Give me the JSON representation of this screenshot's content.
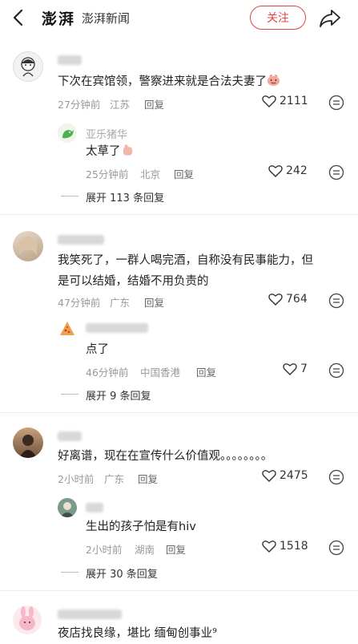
{
  "header": {
    "logo_text": "澎湃",
    "app_name": "澎湃新闻",
    "follow_label": "关注"
  },
  "comments": [
    {
      "text": "下次在宾馆领，警察进来就是合法夫妻了",
      "time": "27分钟前",
      "location": "江苏",
      "reply_label": "回复",
      "likes": "2111",
      "sub_reply": {
        "username": "亚乐猪华",
        "text": "太草了",
        "time": "25分钟前",
        "location": "北京",
        "reply_label": "回复",
        "likes": "242"
      },
      "expand_label": "展开 113 条回复"
    },
    {
      "text_line1": "我笑死了，一群人喝完酒，自称没有民事能力，但",
      "text_line2": "是可以结婚，结婚不用负责的",
      "time": "47分钟前",
      "location": "广东",
      "reply_label": "回复",
      "likes": "764",
      "sub_reply": {
        "text": "点了",
        "time": "46分钟前",
        "location": "中国香港",
        "reply_label": "回复",
        "likes": "7"
      },
      "expand_label": "展开 9 条回复"
    },
    {
      "text": "好离谱，现在在宣传什么价值观。。。。。。。。",
      "time": "2小时前",
      "location": "广东",
      "reply_label": "回复",
      "likes": "2475",
      "sub_reply": {
        "text": "生出的孩子怕是有hiv",
        "time": "2小时前",
        "location": "湖南",
        "reply_label": "回复",
        "likes": "1518"
      },
      "expand_label": "展开 30 条回复"
    },
    {
      "text": "夜店找良缘，堪比 缅甸创事业⁹"
    }
  ],
  "colors": {
    "accent": "#e04545",
    "meta": "#999999"
  }
}
